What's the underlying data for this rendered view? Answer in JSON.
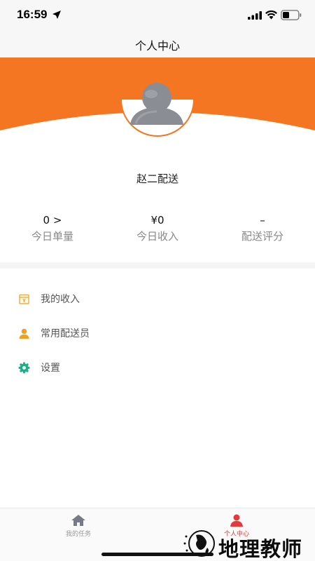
{
  "status_bar": {
    "time": "16:59"
  },
  "nav": {
    "title": "个人中心"
  },
  "header": {
    "accent_color": "#f47522",
    "avatar_icon": "user-avatar-icon"
  },
  "profile": {
    "name": "赵二配送"
  },
  "stats": [
    {
      "value": "0 >",
      "label": "今日单量"
    },
    {
      "value": "¥0",
      "label": "今日收入"
    },
    {
      "value": "–",
      "label": "配送评分"
    }
  ],
  "menu": [
    {
      "label": "我的收入",
      "icon": "wallet-icon",
      "color": "#f0b03a"
    },
    {
      "label": "常用配送员",
      "icon": "person-icon",
      "color": "#f0a020"
    },
    {
      "label": "设置",
      "icon": "gear-icon",
      "color": "#17b388"
    }
  ],
  "tabs": [
    {
      "label": "我的任务",
      "icon": "home-icon",
      "active": false
    },
    {
      "label": "个人中心",
      "icon": "person-icon",
      "active": true
    }
  ],
  "watermark": {
    "text": "地理教师"
  }
}
